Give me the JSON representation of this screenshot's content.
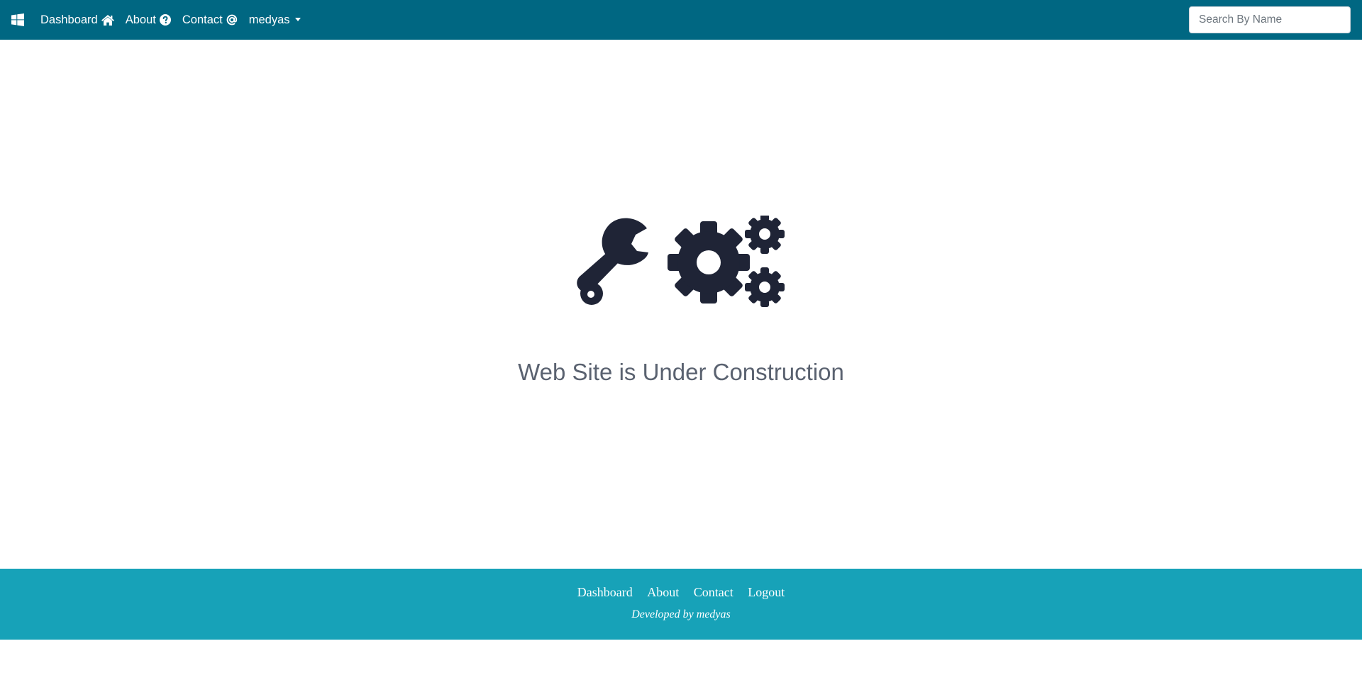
{
  "navbar": {
    "brand_icon": "windows-icon",
    "links": [
      {
        "label": "Dashboard",
        "icon": "home-icon"
      },
      {
        "label": "About",
        "icon": "question-circle-icon"
      },
      {
        "label": "Contact",
        "icon": "at-icon"
      }
    ],
    "user_menu": {
      "label": "medyas",
      "icon": "caret-down-icon"
    },
    "search": {
      "placeholder": "Search By Name",
      "value": ""
    },
    "background_color": "#006782"
  },
  "main": {
    "illustration": "tools-gears-icon",
    "heading": "Web Site is Under Construction"
  },
  "footer": {
    "links": [
      "Dashboard",
      "About",
      "Contact",
      "Logout"
    ],
    "credit": "Developed by medyas",
    "background_color": "#17a2b8"
  }
}
